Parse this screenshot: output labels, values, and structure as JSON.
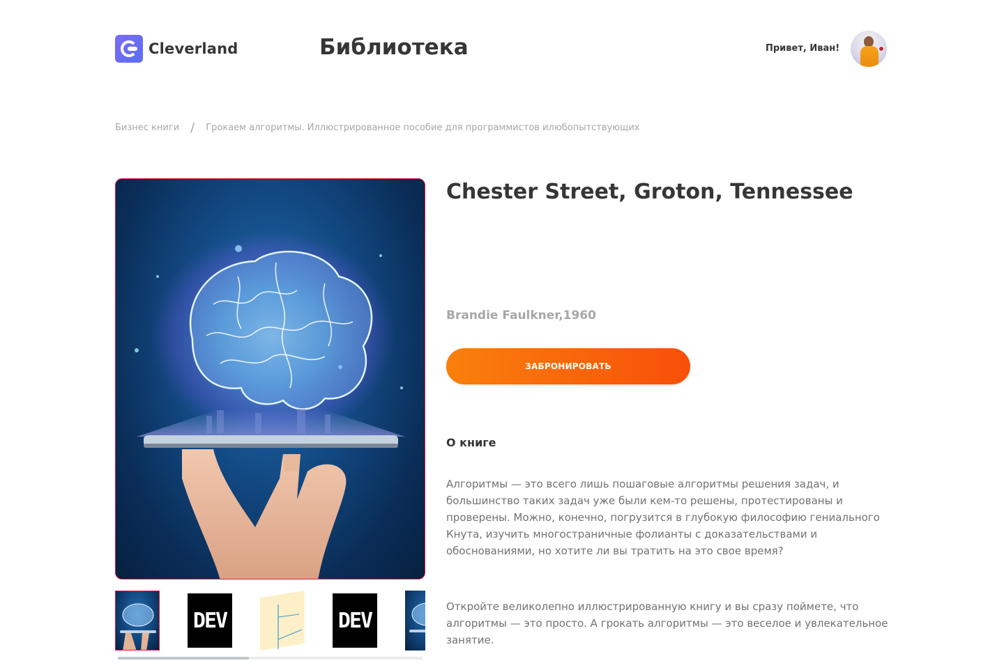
{
  "header": {
    "logo_text": "Cleverland",
    "page_title": "Библиотека",
    "greeting": "Привет, Иван!"
  },
  "breadcrumb": {
    "category": "Бизнес книги",
    "separator": "/",
    "current": "Грокаем алгоритмы. Иллюстрированное пособие для программистов илюбопытствующих"
  },
  "book": {
    "title": "Chester Street, Groton, Tennessee",
    "author_year": "Brandie Faulkner,1960",
    "reserve_label": "ЗАБРОНИРОВАТЬ",
    "about_title": "О книге",
    "description_p1": "Алгоритмы — это всего лишь пошаговые алгоритмы решения задач, и большинство таких задач уже были кем-то решены, протестированы и проверены. Можно, конечно, погрузится в глубокую философию гениального Кнута, изучить многостраничные фолианты с доказательствами и обоснованиями, но хотите ли вы тратить на это свое время?",
    "description_p2": "Откройте великолепно иллюстрированную книгу и вы сразу поймете, что алгоритмы — это просто. А грокать алгоритмы — это веселое и увлекательное занятие."
  },
  "gallery": {
    "thumbnails": [
      {
        "kind": "brain-image",
        "active": true
      },
      {
        "kind": "dev-logo",
        "text": "DEV"
      },
      {
        "kind": "axis-diagram"
      },
      {
        "kind": "dev-logo",
        "text": "DEV"
      },
      {
        "kind": "brain-image"
      }
    ],
    "scroll_fraction": 0.43
  },
  "colors": {
    "accent_gradient_start": "#f9800c",
    "accent_gradient_end": "#f84f09",
    "active_border": "#e01a3f",
    "logo_gradient": "#7b6cf6"
  },
  "icons": {
    "logo": "cleverland-logo-icon",
    "avatar": "user-avatar"
  }
}
